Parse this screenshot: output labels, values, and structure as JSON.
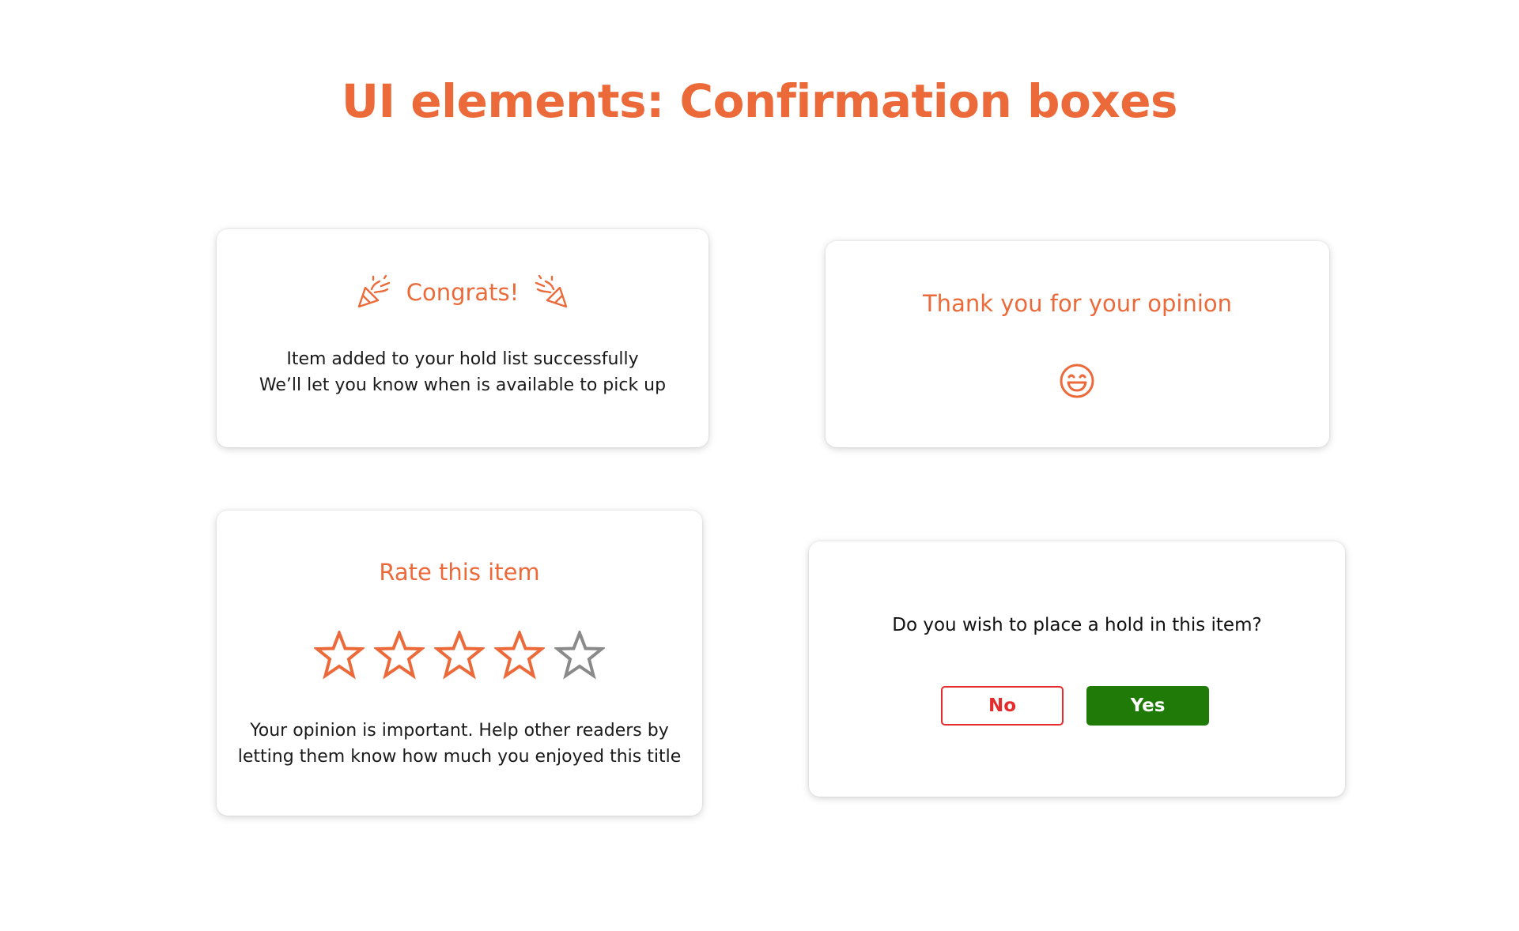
{
  "page": {
    "title": "UI elements: Confirmation boxes"
  },
  "colors": {
    "accent": "#ec6a3a",
    "text": "#1a1a1a",
    "no_red": "#e52b2b",
    "yes_green": "#1f7a08",
    "star_empty": "#8a8a8a"
  },
  "congrats_card": {
    "title": "Congrats!",
    "left_icon": "party-popper-icon",
    "right_icon": "party-popper-icon",
    "line1": "Item added to your hold list successfully",
    "line2": "We’ll let you know when is available to pick up"
  },
  "thanks_card": {
    "title": "Thank you for your opinion",
    "icon": "smiley-face-icon"
  },
  "rate_card": {
    "title": "Rate this item",
    "rating": 4,
    "max_rating": 5,
    "line1": "Your opinion is important. Help other readers by",
    "line2": "letting them know how much you enjoyed this title"
  },
  "hold_card": {
    "question": "Do you wish to place a hold in this item?",
    "no_label": "No",
    "yes_label": "Yes"
  }
}
